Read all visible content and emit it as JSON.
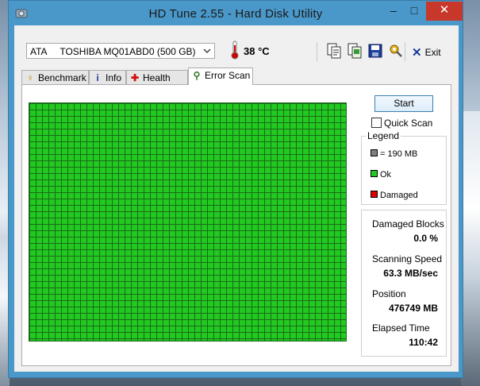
{
  "window": {
    "title": "HD Tune 2.55 - Hard Disk Utility",
    "controls": {
      "minimize": "–",
      "maximize": "□",
      "close": "✕"
    }
  },
  "toolbar": {
    "drive_interface": "ATA",
    "drive_name": "TOSHIBA MQ01ABD0 (500 GB)",
    "temperature": "38 °C",
    "exit_label": "Exit",
    "icons": [
      "copy-text-icon",
      "copy-screenshot-icon",
      "save-icon",
      "options-icon"
    ]
  },
  "tabs": [
    {
      "label": "Benchmark",
      "icon": "benchmark-icon",
      "active": false
    },
    {
      "label": "Info",
      "icon": "info-icon",
      "active": false
    },
    {
      "label": "Health",
      "icon": "health-icon",
      "active": false
    },
    {
      "label": "Error Scan",
      "icon": "magnifier-icon",
      "active": true
    }
  ],
  "scan": {
    "start_label": "Start",
    "quick_scan_label": "Quick Scan",
    "quick_scan_checked": false,
    "block_status": "ok",
    "colors": {
      "ok": "#22c921",
      "damaged": "#e00000",
      "block": "#808080"
    }
  },
  "legend": {
    "title": "Legend",
    "block_size": "= 190 MB",
    "ok_label": "Ok",
    "damaged_label": "Damaged"
  },
  "stats": {
    "damaged_blocks_label": "Damaged Blocks",
    "damaged_blocks_value": "0.0 %",
    "speed_label": "Scanning Speed",
    "speed_value": "63.3 MB/sec",
    "position_label": "Position",
    "position_value": "476749 MB",
    "elapsed_label": "Elapsed Time",
    "elapsed_value": "110:42"
  }
}
